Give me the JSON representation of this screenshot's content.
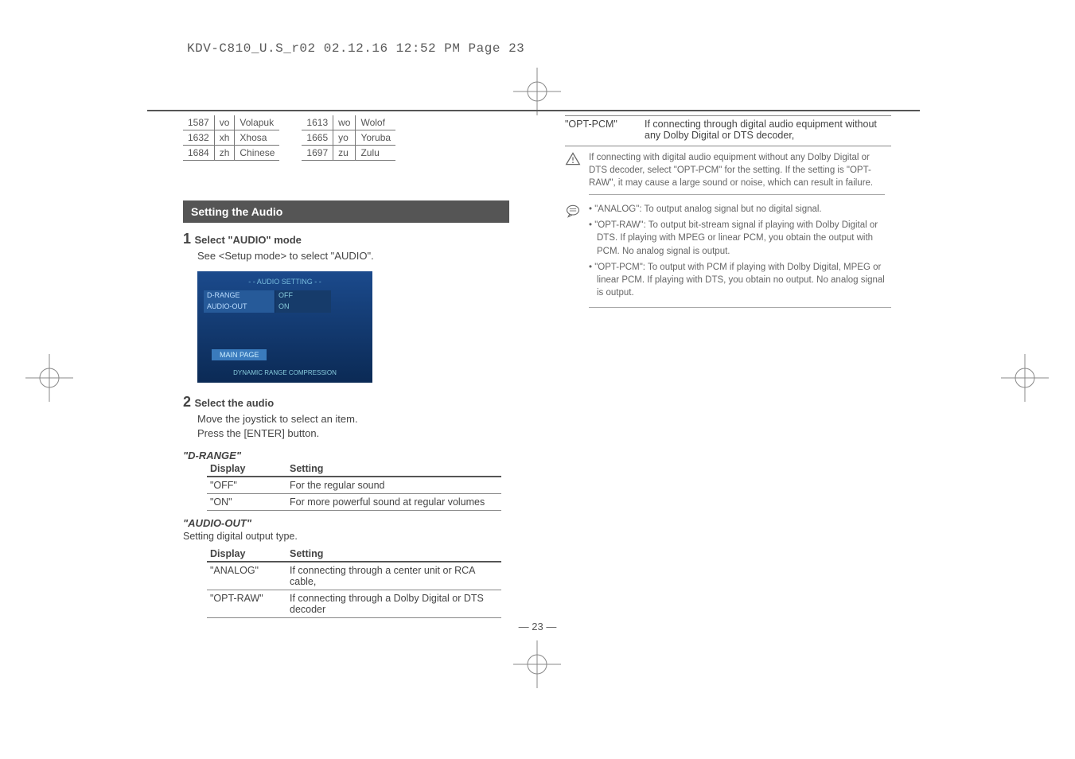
{
  "header": {
    "text": "KDV-C810_U.S_r02  02.12.16  12:52 PM  Page 23"
  },
  "lang_left": [
    {
      "code": "1587",
      "abbr": "vo",
      "name": "Volapuk"
    },
    {
      "code": "1632",
      "abbr": "xh",
      "name": "Xhosa"
    },
    {
      "code": "1684",
      "abbr": "zh",
      "name": "Chinese"
    }
  ],
  "lang_right": [
    {
      "code": "1613",
      "abbr": "wo",
      "name": "Wolof"
    },
    {
      "code": "1665",
      "abbr": "yo",
      "name": "Yoruba"
    },
    {
      "code": "1697",
      "abbr": "zu",
      "name": "Zulu"
    }
  ],
  "section_title": "Setting the Audio",
  "step1": {
    "num": "1",
    "title": "Select \"AUDIO\" mode",
    "body": "See <Setup mode> to select \"AUDIO\"."
  },
  "osd": {
    "title": "- - AUDIO SETTING - -",
    "rows": [
      {
        "l": "D-RANGE",
        "r": "OFF"
      },
      {
        "l": "AUDIO-OUT",
        "r": "ON"
      }
    ],
    "btn": "MAIN PAGE",
    "foot": "DYNAMIC RANGE COMPRESSION"
  },
  "step2": {
    "num": "2",
    "title": "Select the audio",
    "body1": "Move the joystick to select an item.",
    "body2": "Press the [ENTER] button."
  },
  "drange": {
    "heading": "\"D-RANGE\"",
    "cols": {
      "c1": "Display",
      "c2": "Setting"
    },
    "rows": [
      {
        "d": "\"OFF\"",
        "s": "For the regular sound"
      },
      {
        "d": "\"ON\"",
        "s": "For more powerful sound at regular volumes"
      }
    ]
  },
  "audioout": {
    "heading": "\"AUDIO-OUT\"",
    "desc": "Setting digital output type.",
    "cols": {
      "c1": "Display",
      "c2": "Setting"
    },
    "rows": [
      {
        "d": "\"ANALOG\"",
        "s": "If connecting through a center unit or RCA cable,"
      },
      {
        "d": "\"OPT-RAW\"",
        "s": "If connecting through a Dolby Digital or DTS decoder"
      }
    ]
  },
  "rcol": {
    "row": {
      "d": "\"OPT-PCM\"",
      "s": "If connecting through digital audio equipment without any Dolby Digital or DTS decoder,"
    },
    "warn": "If connecting with digital audio equipment without any Dolby Digital or DTS decoder, select \"OPT-PCM\" for the setting. If the setting is \"OPT-RAW\", it may cause a large sound or noise, which can result in failure.",
    "bul1": "• \"ANALOG\": To output analog signal but no digital signal.",
    "bul2": "• \"OPT-RAW\": To output bit-stream signal if playing with Dolby Digital or DTS. If playing with MPEG or linear PCM, you obtain the output with PCM. No analog signal is output.",
    "bul3": "• \"OPT-PCM\": To output with PCM if playing with Dolby Digital, MPEG or linear PCM. If playing with DTS, you obtain no output. No analog signal is output."
  },
  "pagenum": "— 23 —",
  "icons": {
    "warn": "warning-triangle",
    "note": "note-bubble"
  }
}
